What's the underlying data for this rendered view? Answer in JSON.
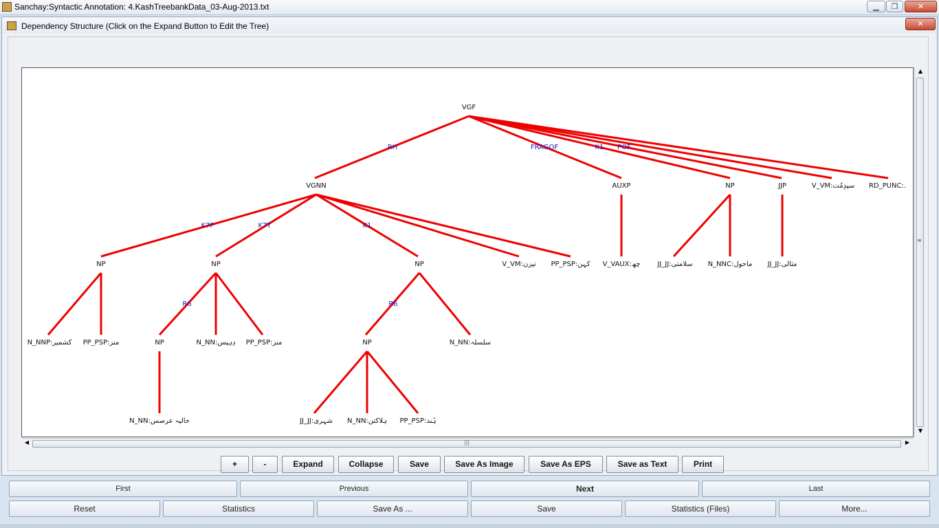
{
  "window": {
    "title": "Sanchay:Syntactic Annotation: 4.KashTreebankData_03-Aug-2013.txt",
    "minimize_label": "▁",
    "restore_label": "❐",
    "close_label": "✕"
  },
  "dialog": {
    "title": "Dependency Structure (Click on the Expand Button to Edit the Tree)",
    "close_label": "✕"
  },
  "tree": {
    "nodes": {
      "vgf": "VGF",
      "vgnn": "VGNN",
      "auxp": "AUXP",
      "np_r1": "NP",
      "jjp": "JJP",
      "v_vm_r1": "V_VM:سپدٕمُت",
      "rd_punc": "RD_PUNC:.",
      "np_a": "NP",
      "np_b": "NP",
      "np_c": "NP",
      "v_vm_2": "V_VM:تیزن",
      "pp_psp_2": "PP_PSP:کہن",
      "v_vaux": "V_VAUX:چھ",
      "jj_jj_1": "JJ_JJ:سلامتی",
      "n_nnc": "N_NNC:ماحول",
      "jj_jj_2": "JJ_JJ:مثالی",
      "n_nnp": "N_NNP:کشمیر",
      "pp_psp_a": "PP_PSP:منز",
      "np_b1": "NP",
      "n_nn_b": "N_NN:دِہیس",
      "pp_psp_b": "PP_PSP:منز",
      "np_c1": "NP",
      "n_nn_c": "N_NN:سلسلہ",
      "n_nn_b1": "N_NN:حالیہ عرصس",
      "jj_jj_c": "JJ_JJ:شہری",
      "n_nn_c1": "N_NN:ہلاکتن",
      "pp_psp_c": "PP_PSP:ہُند"
    },
    "edge_labels": {
      "rh": "RH",
      "fragof": "FRAGOF",
      "k1_top": "K1",
      "pof": "POF",
      "k7p": "K7P",
      "k7t": "K7T",
      "k1_mid": "K1",
      "r6_b": "R6",
      "r6_c": "R6"
    }
  },
  "toolbar": {
    "zoom_in": "+",
    "zoom_out": "-",
    "expand": "Expand",
    "collapse": "Collapse",
    "save": "Save",
    "save_as_image": "Save As Image",
    "save_as_eps": "Save As EPS",
    "save_as_text": "Save as Text",
    "print": "Print"
  },
  "nav_row1": {
    "first": "First",
    "previous": "Previous",
    "next": "Next",
    "last": "Last"
  },
  "nav_row2": {
    "reset": "Reset",
    "statistics": "Statistics",
    "save_as": "Save As ...",
    "save": "Save",
    "statistics_files": "Statistics (Files)",
    "more": "More..."
  },
  "colors": {
    "edge": "#ee0000",
    "edge_label": "#1a1ab8"
  }
}
